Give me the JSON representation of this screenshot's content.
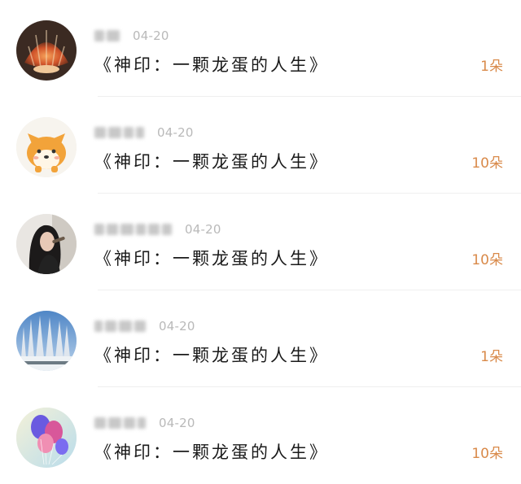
{
  "accent_color": "#d98a4a",
  "items": [
    {
      "avatar_icon": "shell-avatar-icon",
      "date": "04-20",
      "title": "《神印：一颗龙蛋的人生》",
      "count": "1朵"
    },
    {
      "avatar_icon": "shiba-dog-avatar-icon",
      "date": "04-20",
      "title": "《神印：一颗龙蛋的人生》",
      "count": "10朵"
    },
    {
      "avatar_icon": "girl-portrait-avatar-icon",
      "date": "04-20",
      "title": "《神印：一颗龙蛋的人生》",
      "count": "10朵"
    },
    {
      "avatar_icon": "winter-trees-avatar-icon",
      "date": "04-20",
      "title": "《神印：一颗龙蛋的人生》",
      "count": "1朵"
    },
    {
      "avatar_icon": "balloons-avatar-icon",
      "date": "04-20",
      "title": "《神印：一颗龙蛋的人生》",
      "count": "10朵"
    }
  ]
}
